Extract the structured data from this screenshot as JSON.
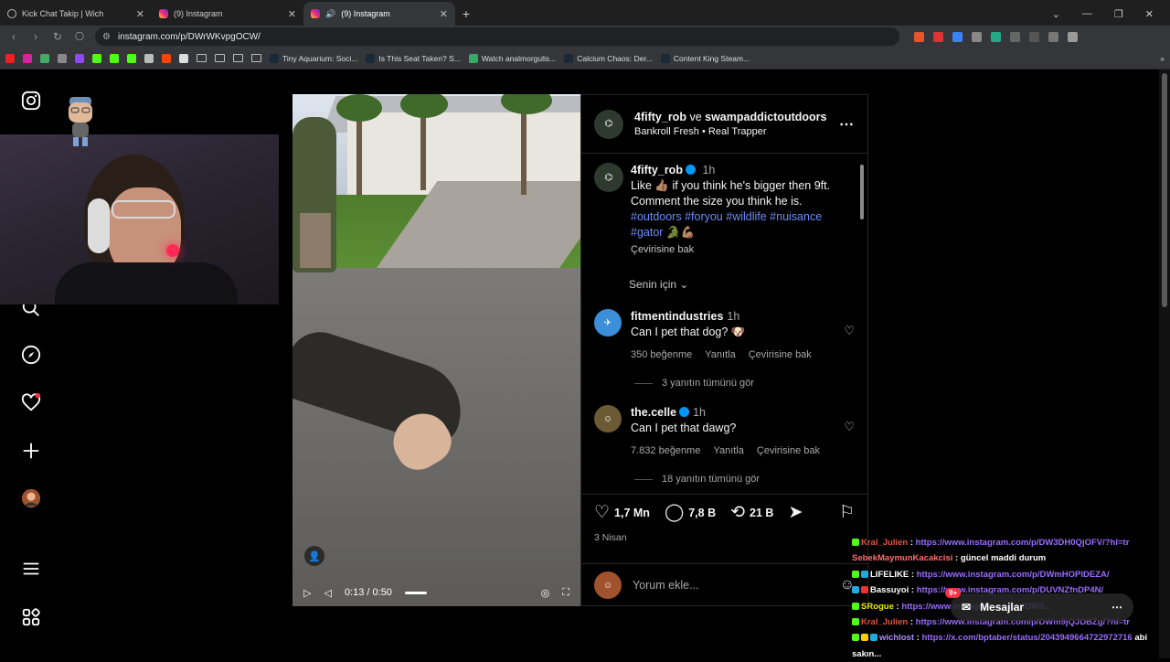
{
  "browser": {
    "tabs": [
      {
        "title": "Kick Chat Takip | Wich",
        "active": false
      },
      {
        "title": "(9) Instagram",
        "active": false
      },
      {
        "title": "(9) Instagram",
        "active": true
      }
    ],
    "url": "instagram.com/p/DWrWKvpgOCW/",
    "bookmarks": [
      "Tiny Aquarium: Soci...",
      "Is This Seat Taken? S...",
      "Watch analmorgulis...",
      "Calcium Chaos: Der...",
      "Content King Steam..."
    ]
  },
  "sidebar": {
    "icons": [
      "instagram-logo-icon",
      "search-icon",
      "explore-icon",
      "notifications-heart-icon",
      "create-plus-icon",
      "profile-avatar-icon",
      "menu-icon",
      "more-apps-icon"
    ]
  },
  "video": {
    "time": "0:13 / 0:50",
    "progress": 0.26
  },
  "post": {
    "header_user1": "4fifty_rob",
    "header_and": "ve",
    "header_user2": "swampaddictoutdoors",
    "audio_artist": "Bankroll Fresh",
    "audio_sep": "•",
    "audio_track": "Real Trapper",
    "caption_user": "4fifty_rob",
    "caption_time": "1h",
    "caption_line1": "Like 👍🏽 if you think he's bigger then 9ft.",
    "caption_line2": "Comment the size you think he is.",
    "hashtags": "#outdoors #foryou #wildlife #nuisance",
    "hashtags2": "#gator 🐊💪🏽",
    "translate": "Çevirisine bak",
    "for_you": "Senin için",
    "comments": [
      {
        "user": "fitmentindustries",
        "time": "1h",
        "text": "Can I pet that dog? 🐶",
        "likes": "350 beğenme",
        "reply": "Yanıtla",
        "translate": "Çevirisine bak",
        "replies": "3 yanıtın tümünü gör",
        "verified": false
      },
      {
        "user": "the.celle",
        "time": "1h",
        "text": "Can I pet that dawg?",
        "likes": "7.832 beğenme",
        "reply": "Yanıtla",
        "translate": "Çevirisine bak",
        "replies": "18 yanıtın tümünü gör",
        "verified": true
      }
    ],
    "like_count": "1,7 Mn",
    "comment_count": "7,8 B",
    "repost_count": "21 B",
    "date": "3 Nisan",
    "comment_placeholder": "Yorum ekle..."
  },
  "chat": [
    {
      "user": "Kral_Julien",
      "sep": ":",
      "text": "https://www.instagram.com/p/DW3DH0QjOFV/?hl=tr",
      "link": true
    },
    {
      "user": "SebekMaymunKacakcisi",
      "sep": ":",
      "text": "güncel maddi durum",
      "link": false
    },
    {
      "user": "LIFELIKE",
      "sep": ":",
      "text": "https://www.instagram.com/p/DWmHOPlDEZA/",
      "link": true
    },
    {
      "user": "Bassuyoi",
      "sep": ":",
      "text": "https://www.instagram.com/p/DUVNZfnDP4N/",
      "link": true
    },
    {
      "user": "SRogue",
      "sep": ":",
      "text": "https://www.instagram.com/p/DW3...",
      "link": true
    },
    {
      "user": "Kral_Julien",
      "sep": ":",
      "text": "https://www.instagram.com/p/DWm9jQJDBZg/?hl=tr",
      "link": true
    },
    {
      "user": "wichlost",
      "sep": ":",
      "text": "https://x.com/bptaber/status/2043949664722972716",
      "link": true,
      "suffix": "abi"
    },
    {
      "user": "",
      "sep": "",
      "text": "sakın...",
      "link": false
    }
  ],
  "messages_pill": {
    "label": "Mesajlar",
    "count": "9+"
  }
}
